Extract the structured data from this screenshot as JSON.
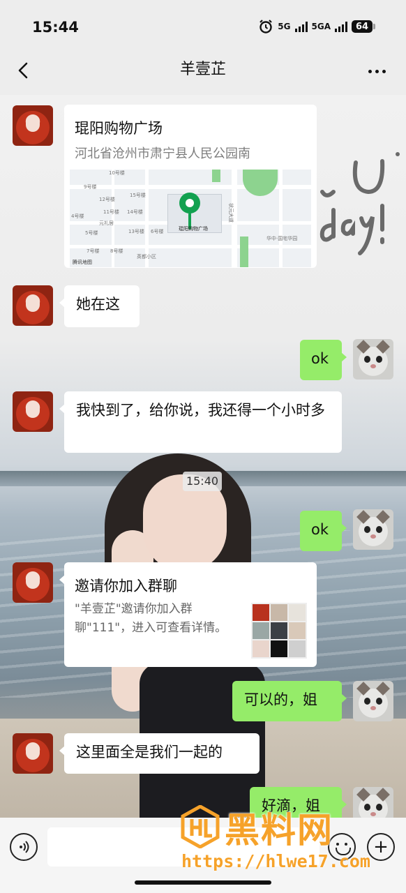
{
  "status_bar": {
    "time": "15:44",
    "network_1": "5G",
    "network_2": "5GA",
    "battery": "64"
  },
  "header": {
    "title": "羊壹芷",
    "back_icon": "chevron-left-icon",
    "more_icon": "more-dots-icon"
  },
  "messages": [
    {
      "type": "location",
      "sender": "other",
      "name": "琨阳购物广场",
      "address": "河北省沧州市肃宁县人民公园南",
      "map_poi": "琨阳购物广场",
      "map_credit": "腾讯地图",
      "map_labels": [
        "10号楼",
        "15号楼",
        "12号楼",
        "11号楼",
        "14号楼",
        "13号楼",
        "7号楼",
        "8号楼",
        "5号楼",
        "6号楼",
        "元礼居",
        "英都小区",
        "华中·国宅华园",
        "状元大道",
        "4号楼",
        "9号楼"
      ]
    },
    {
      "type": "text",
      "sender": "other",
      "text": "她在这"
    },
    {
      "type": "text",
      "sender": "me",
      "text": "ok"
    },
    {
      "type": "text",
      "sender": "other",
      "text": "我快到了，给你说，我还得一个小时多"
    },
    {
      "type": "time",
      "text": "15:40"
    },
    {
      "type": "text",
      "sender": "me",
      "text": "ok"
    },
    {
      "type": "group_invite",
      "sender": "other",
      "title": "邀请你加入群聊",
      "desc": "\"羊壹芷\"邀请你加入群聊\"111\"，进入可查看详情。"
    },
    {
      "type": "text",
      "sender": "me",
      "text": "可以的，姐"
    },
    {
      "type": "text",
      "sender": "other",
      "text": "这里面全是我们一起的"
    },
    {
      "type": "text",
      "sender": "me",
      "text": "好滴，姐"
    }
  ],
  "input_bar": {
    "voice_icon": "voice-icon",
    "emoji_icon": "emoji-icon",
    "plus_icon": "plus-icon",
    "value": ""
  },
  "watermark": {
    "brand": "黑料网",
    "url": "https://hlwe17.com"
  },
  "colors": {
    "bubble_me": "#95ec69",
    "bubble_other": "#ffffff",
    "bar_bg": "#ededed",
    "map_pin": "#12a150",
    "watermark": "#f6a22a"
  }
}
